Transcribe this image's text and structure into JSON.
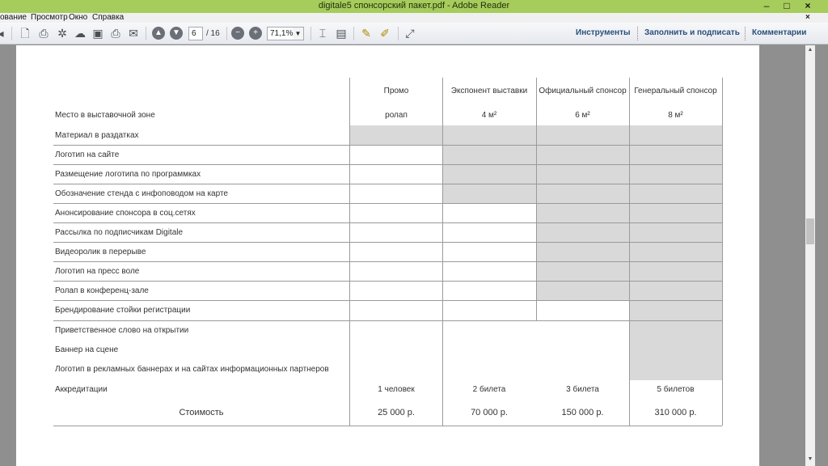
{
  "window": {
    "title": "digitale5 спонсорский пакет.pdf - Adobe Reader",
    "controls": {
      "minimize": "–",
      "maximize": "□",
      "close": "×"
    }
  },
  "menu": {
    "items": [
      "ование",
      "Просмотр",
      "Окно",
      "Справка"
    ],
    "close_doc": "×"
  },
  "toolbar": {
    "page_current": "6",
    "page_total": "/ 16",
    "zoom": "71,1%",
    "right_tools": [
      "Инструменты",
      "Заполнить и подписать",
      "Комментарии"
    ],
    "icons": [
      "open-icon",
      "create-icon",
      "settings-icon",
      "cloud-icon",
      "save-icon",
      "print-icon",
      "email-icon",
      "prev-page-icon",
      "next-page-icon",
      "zoom-out-icon",
      "zoom-in-icon",
      "select-icon",
      "hand-icon",
      "comment-icon",
      "highlight-icon",
      "fullscreen-icon"
    ]
  },
  "table": {
    "headers": [
      "Промо",
      "Экспонент выставки",
      "Официальный спонсор",
      "Генеральный спонсор"
    ],
    "space_row": {
      "label": "Место в выставочной зоне",
      "values": [
        "ролап",
        "4 м²",
        "6 м²",
        "8 м²"
      ]
    },
    "rows": [
      "Материал в раздатках",
      "Логотип на сайте",
      "Размещение логотипа по программках",
      "Обозначение стенда с инфоповодом на карте",
      "Анонсирование спонсора в соц.сетях",
      "Рассылка по подписчикам Digitale",
      "Видеоролик в перерыве",
      "Логотип на пресс воле",
      "Ролап в конференц-зале",
      "Брендирование стойки регистрации",
      "Приветственное слово на открытии",
      "Баннер на сцене",
      "Логотип в рекламных баннерах и на сайтах информационных партнеров"
    ],
    "accreditation": {
      "label": "Аккредитации",
      "values": [
        "1 человек",
        "2 билета",
        "3 билета",
        "5 билетов"
      ]
    },
    "cost": {
      "label": "Стоимость",
      "values": [
        "25 000 р.",
        "70 000 р.",
        "150 000 р.",
        "310 000 р."
      ]
    }
  }
}
